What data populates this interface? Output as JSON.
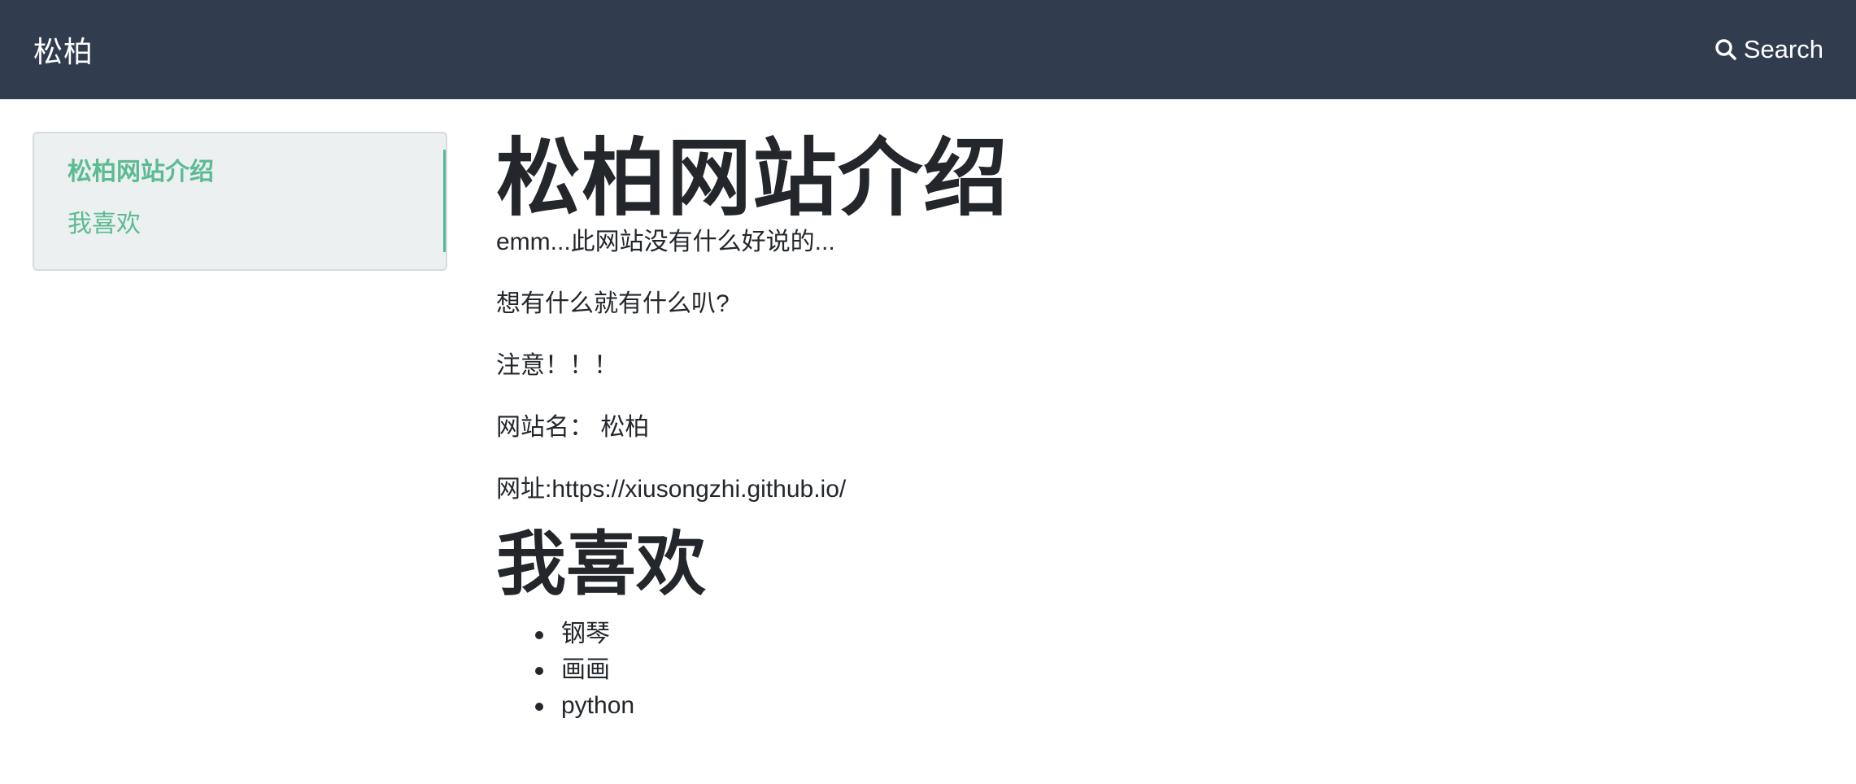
{
  "header": {
    "brand": "松柏",
    "search_label": "Search"
  },
  "toc": {
    "items": [
      {
        "label": "松柏网站介绍",
        "active": true
      },
      {
        "label": "我喜欢",
        "active": false
      }
    ],
    "accent_color": "#5bbb93"
  },
  "content": {
    "title": "松柏网站介绍",
    "paragraphs": [
      "emm...此网站没有什么好说的...",
      "想有什么就有什么叭?",
      "注意！！！",
      "网站名： 松柏",
      "网址:https://xiusongzhi.github.io/"
    ],
    "section2_title": "我喜欢",
    "likes": [
      "钢琴",
      "画画",
      "python"
    ]
  },
  "colors": {
    "topbar": "#313d4f",
    "toc_bg": "#ecf0f1",
    "text": "#23272b"
  },
  "icons": {
    "search": "search-icon"
  }
}
